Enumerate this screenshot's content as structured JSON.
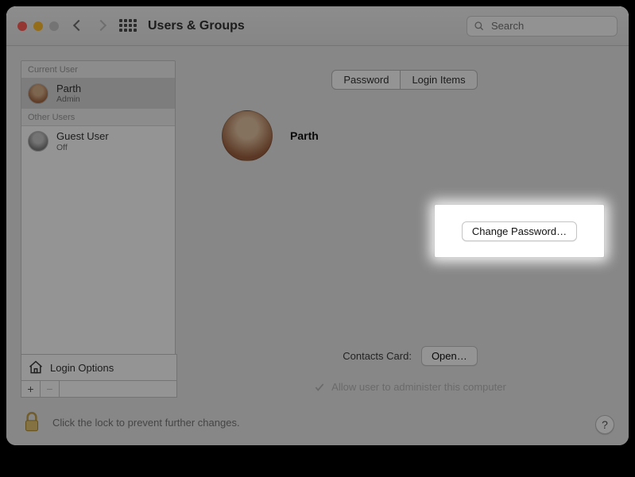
{
  "window": {
    "title": "Users & Groups"
  },
  "search": {
    "placeholder": "Search"
  },
  "sidebar": {
    "current_header": "Current User",
    "other_header": "Other Users",
    "current_user": {
      "name": "Parth",
      "role": "Admin"
    },
    "other_users": [
      {
        "name": "Guest User",
        "role": "Off"
      }
    ],
    "login_options": "Login Options"
  },
  "tabs": {
    "password": "Password",
    "login_items": "Login Items"
  },
  "profile": {
    "name": "Parth"
  },
  "buttons": {
    "change_password": "Change Password…",
    "open": "Open…"
  },
  "contacts_label": "Contacts Card:",
  "admin_checkbox": "Allow user to administer this computer",
  "footer": "Click the lock to prevent further changes.",
  "help": "?"
}
